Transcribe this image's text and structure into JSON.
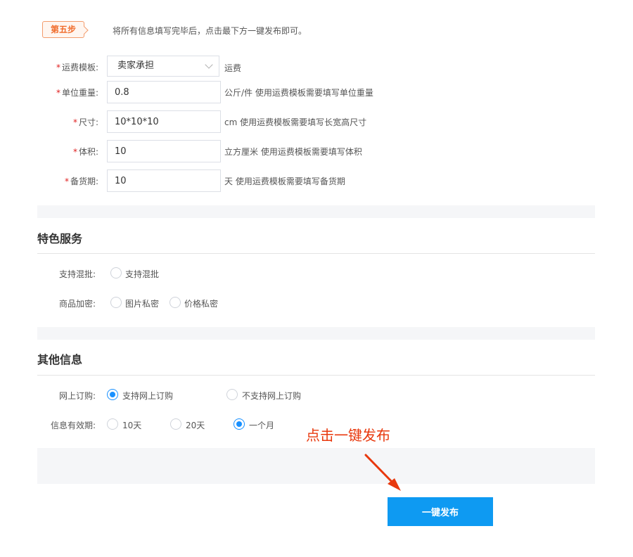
{
  "step": {
    "badge": "第五步",
    "instruction": "将所有信息填写完毕后，点击最下方一键发布即可。"
  },
  "shipping": {
    "template": {
      "label": "运费模板:",
      "value": "卖家承担",
      "hint": "运费"
    },
    "unit_weight": {
      "label": "单位重量:",
      "value": "0.8",
      "hint": "公斤/件 使用运费模板需要填写单位重量"
    },
    "size": {
      "label": "尺寸:",
      "value": "10*10*10",
      "hint": "cm 使用运费模板需要填写长宽高尺寸"
    },
    "volume": {
      "label": "体积:",
      "value": "10",
      "hint": "立方厘米 使用运费模板需要填写体积"
    },
    "stock_period": {
      "label": "备货期:",
      "value": "10",
      "hint": "天 使用运费模板需要填写备货期"
    },
    "required_mark": "*"
  },
  "special_services": {
    "title": "特色服务",
    "mixed_batch": {
      "label": "支持混批:",
      "option": "支持混批",
      "checked": false
    },
    "encryption": {
      "label": "商品加密:",
      "options": [
        {
          "text": "图片私密",
          "checked": false
        },
        {
          "text": "价格私密",
          "checked": false
        }
      ]
    }
  },
  "other_info": {
    "title": "其他信息",
    "online_order": {
      "label": "网上订购:",
      "options": [
        {
          "text": "支持网上订购",
          "checked": true
        },
        {
          "text": "不支持网上订购",
          "checked": false
        }
      ]
    },
    "validity": {
      "label": "信息有效期:",
      "options": [
        {
          "text": "10天",
          "checked": false
        },
        {
          "text": "20天",
          "checked": false
        },
        {
          "text": "一个月",
          "checked": true
        }
      ]
    }
  },
  "annotation": {
    "text": "点击一键发布",
    "color": "#e8380d"
  },
  "publish_button": {
    "label": "一键发布",
    "color": "#0e9af2"
  },
  "colors": {
    "accent": "#1890ff",
    "badge": "#f06b2a",
    "required": "#e02020"
  }
}
